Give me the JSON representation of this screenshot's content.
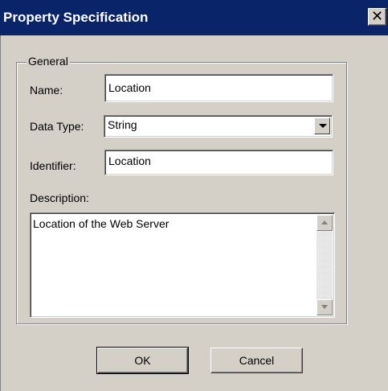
{
  "window": {
    "title": "Property Specification",
    "close_glyph": "✕",
    "title_bar_color": "#0a246a",
    "face_color": "#d4d0c8"
  },
  "general_group": {
    "label": "General",
    "name": {
      "label": "Name:",
      "value": "Location"
    },
    "data_type": {
      "label": "Data Type:",
      "selected": "String"
    },
    "identifier": {
      "label": "Identifier:",
      "value": "Location"
    },
    "description": {
      "label": "Description:",
      "value": "Location of the Web Server"
    }
  },
  "buttons": {
    "ok": "OK",
    "cancel": "Cancel"
  }
}
